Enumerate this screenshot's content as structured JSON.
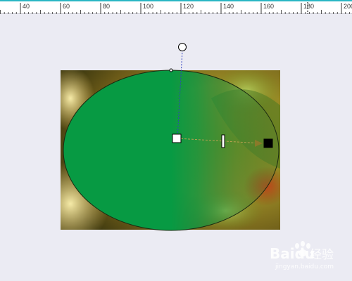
{
  "colors": {
    "ruler_accent": "#2bb6c4",
    "canvas_background": "#ebebf3",
    "ellipse_fill": "#079a43",
    "blend_arrow": "#8a7a2a",
    "start_handle": "#ffffff",
    "end_handle": "#000000"
  },
  "ruler": {
    "ticks": [
      "40",
      "60",
      "80",
      "100",
      "120",
      "140",
      "160",
      "180",
      "200"
    ]
  },
  "canvas": {
    "shape": "ellipse",
    "tool": "transparency-blend",
    "icons": {
      "rotation_handle": "circle-handle-icon",
      "start_handle": "white-square-handle-icon",
      "end_handle": "black-square-handle-icon",
      "midpoint": "slider-bar-icon"
    }
  },
  "watermark": {
    "brand": "Baidu",
    "cn": "经验",
    "url": "jingyan.baidu.com"
  }
}
